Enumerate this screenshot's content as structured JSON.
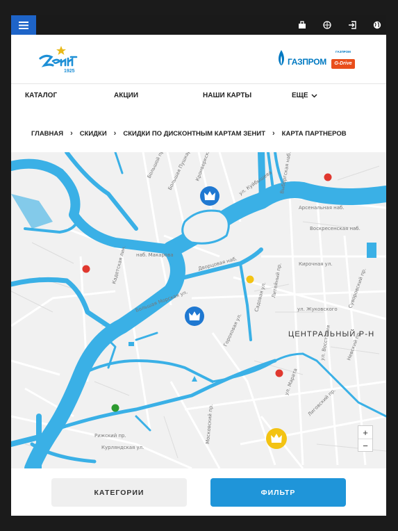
{
  "topbar": {
    "menu_icon": "hamburger-icon",
    "icons": [
      "bag-icon",
      "basketball-icon",
      "login-icon",
      "globe-icon"
    ]
  },
  "header": {
    "club_logo_year": "1925",
    "sponsor_name": "ГАЗПРОМ",
    "sponsor_small_1": "ГАЗПРОМ",
    "sponsor_small_2": "G-Drive"
  },
  "nav": {
    "items": [
      "КАТАЛОГ",
      "АКЦИИ",
      "НАШИ КАРТЫ",
      "ЕЩЕ"
    ]
  },
  "breadcrumbs": [
    "ГЛАВНАЯ",
    "СКИДКИ",
    "СКИДКИ ПО ДИСКОНТНЫМ КАРТАМ ЗЕНИТ",
    "КАРТА ПАРТНЕРОВ"
  ],
  "map": {
    "district_label": "ЦЕНТРАЛЬНЫЙ Р-Н",
    "streets": [
      "Большой проспект П.С.",
      "Большая Пушкарская ул.",
      "Кронверкская ул.",
      "ул. Куйбышева",
      "Выборгская наб.",
      "Арсенальная наб.",
      "Воскресенская наб.",
      "Кирочная ул.",
      "Литейный пр.",
      "ул. Жуковского",
      "Суворовский пр.",
      "Невский пр.",
      "ул. Марата",
      "Лиговский пр.",
      "Московский пр.",
      "Садовая ул.",
      "Рижский пр.",
      "Курляндская ул.",
      "Кадетская лин.",
      "наб. Макарова",
      "ул. Восстания",
      "Дворцовая наб.",
      "Большая Морская ул.",
      "Гороховая ул."
    ],
    "zoom_in": "+",
    "zoom_out": "−",
    "marker_colors": {
      "red": "#e0382f",
      "yellow": "#f3c313",
      "green": "#2d9a2f",
      "blue": "#1f78d1"
    }
  },
  "buttons": {
    "categories": "КАТЕГОРИИ",
    "filter": "ФИЛЬТР"
  },
  "colors": {
    "accent": "#1f95d9",
    "menu": "#1e64c8",
    "water": "#3ab0e6"
  }
}
